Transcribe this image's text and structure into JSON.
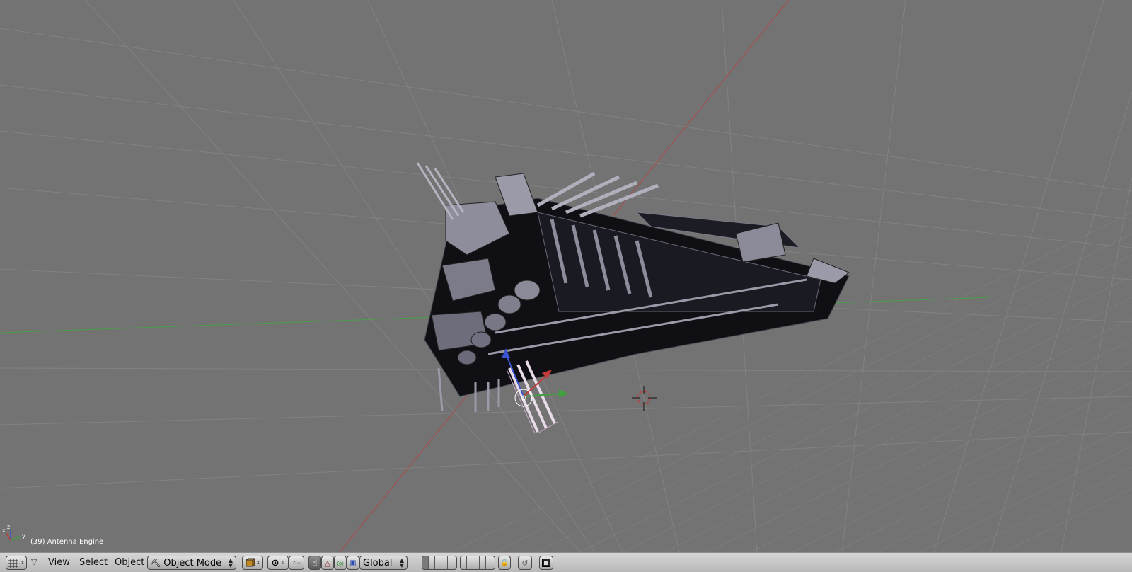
{
  "viewport": {
    "status_text": "(39) Antenna Engine",
    "background": "#737373",
    "axis_colors": {
      "x": "#c23a3a",
      "y": "#3fa23f",
      "z": "#3a54d0"
    },
    "axis_labels": {
      "x": "x",
      "y": "y",
      "z": "z"
    }
  },
  "header": {
    "editor_type_icon": "grid-icon",
    "menus": [
      "View",
      "Select",
      "Object"
    ],
    "mode": {
      "label": "Object Mode",
      "icon": "object-mode-icon"
    },
    "draw_type_icon": "solid-shading-icon",
    "pivot_icon": "pivot-icon",
    "manipulator_icons": [
      "hand-icon",
      "translate-icon",
      "rotate-icon",
      "scale-icon"
    ],
    "orientation": "Global",
    "lock_icon": "lock-icon",
    "render_icon": "render-icon"
  }
}
